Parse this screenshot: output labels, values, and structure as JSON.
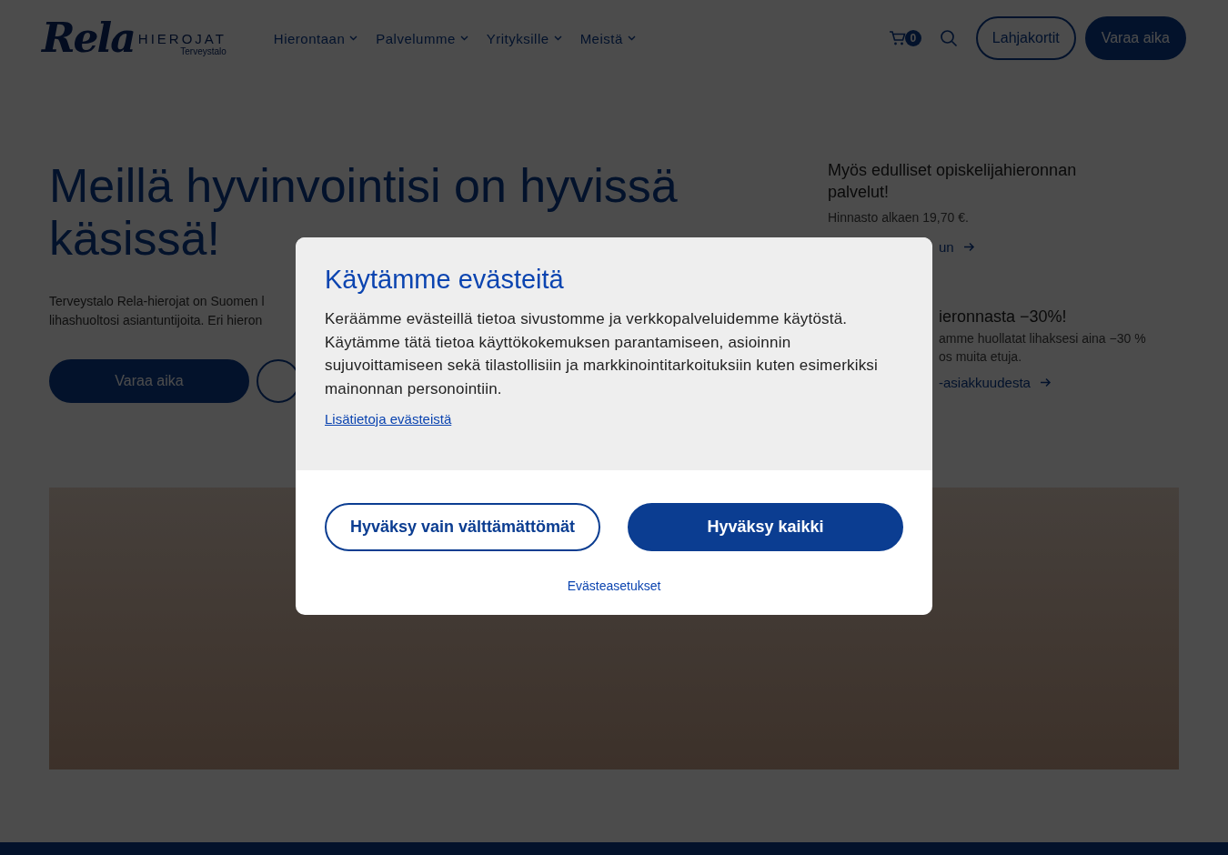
{
  "header": {
    "logo": {
      "wordmark": "Rela",
      "subtitle": "HIEROJAT",
      "brand": "Terveystalo"
    },
    "nav": [
      {
        "label": "Hierontaan"
      },
      {
        "label": "Palvelumme"
      },
      {
        "label": "Yrityksille"
      },
      {
        "label": "Meistä"
      }
    ],
    "cart_count": "0",
    "buttons": [
      {
        "label": "Lahjakortit",
        "kind": "outline"
      },
      {
        "label": "Varaa aika",
        "kind": "filled"
      }
    ]
  },
  "hero": {
    "title": "Meillä hyvinvointisi on hyvissä käsissä!",
    "intro_lines": [
      "Terveystalo Rela-hierojat on Suomen l",
      "lihashuoltosi asiantuntijoita. Eri hieron"
    ],
    "buttons": [
      {
        "label": "Varaa aika",
        "kind": "filled"
      },
      {
        "kind": "outline"
      }
    ]
  },
  "promos": [
    {
      "title": "Myös edulliset opiskelijahieronnan palvelut!",
      "text_lines": [
        "Hinnasto alkaen 19,70 €."
      ],
      "link": "un"
    },
    {
      "title": "ieronnasta −30%!",
      "text_lines": [
        "amme huollatat lihaksesi aina −30 %",
        "os muita etuja."
      ],
      "link": "-asiakkuudesta"
    }
  ],
  "cookie_dialog": {
    "title": "Käytämme evästeitä",
    "body": "Keräämme evästeillä tietoa sivustomme ja verkkopalveluidemme käytöstä. Käytämme tätä tietoa käyttökokemuksen parantamiseen, asioinnin sujuvoittamiseen sekä tilastollisiin ja markkinointitarkoituksiin kuten esimerkiksi mainonnan personointiin.",
    "link": "Lisätietoja evästeistä",
    "buttons": [
      {
        "label": "Hyväksy vain välttämättömät",
        "kind": "outline"
      },
      {
        "label": "Hyväksy kaikki",
        "kind": "filled"
      }
    ],
    "settings_link": "Evästeasetukset"
  }
}
